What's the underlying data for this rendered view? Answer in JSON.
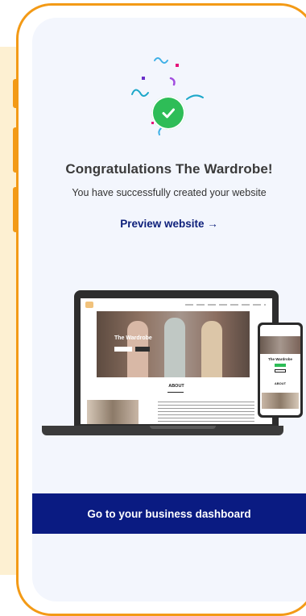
{
  "congrats_title": "Congratulations The Wardrobe!",
  "subtitle": "You have successfully created your website",
  "preview_link": "Preview website →",
  "cta_label": "Go to your business dashboard",
  "mockup": {
    "hero_title": "The Wardrobe",
    "about_heading": "ABOUT"
  },
  "colors": {
    "accent": "#0a1b82",
    "success": "#2ebd57",
    "frame": "#f39a16"
  },
  "icons": {
    "success": "check-circle-icon"
  }
}
